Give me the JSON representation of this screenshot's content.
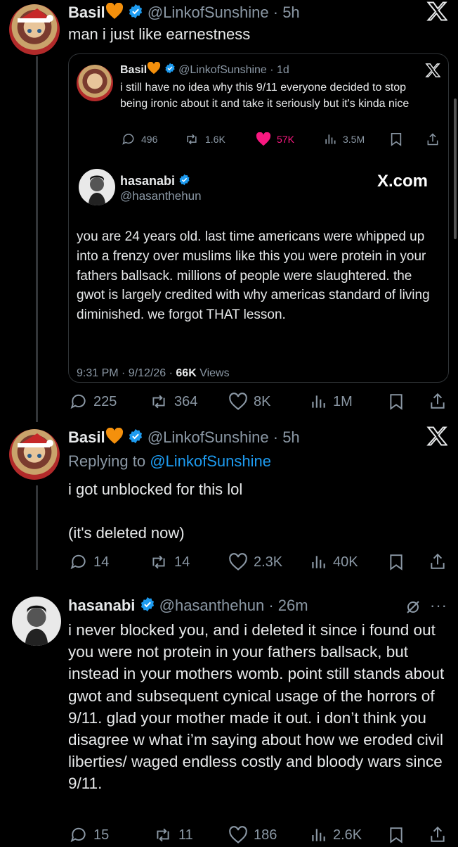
{
  "tweet1": {
    "name": "Basil",
    "handle": "@LinkofSunshine",
    "time": "5h",
    "text": "man i just like earnestness",
    "quote": {
      "name": "Basil",
      "handle": "@LinkofSunshine",
      "time": "1d",
      "text": "i still have no idea why this 9/11 everyone decided to stop being ironic about it and take it seriously but it's kinda nice",
      "stats": {
        "replies": "496",
        "reposts": "1.6K",
        "likes": "57K",
        "views": "3.5M"
      },
      "embed": {
        "name": "hasanabi",
        "handle": "@hasanthehun",
        "brand": "X.com",
        "text": "you are 24 years old. last time americans were whipped up into a frenzy over muslims like this you were protein in your fathers ballsack. millions of people were slaughtered. the gwot is largely credited with why americas standard of living diminished. we forgot THAT lesson.",
        "meta_prefix": "9:31 PM · 9/12/26 · ",
        "meta_views": "66K",
        "meta_suffix": " Views"
      }
    },
    "stats": {
      "replies": "225",
      "reposts": "364",
      "likes": "8K",
      "views": "1M"
    }
  },
  "tweet2": {
    "name": "Basil",
    "handle": "@LinkofSunshine",
    "time": "5h",
    "replying_prefix": "Replying to ",
    "replying_to": "@LinkofSunshine",
    "text1": "i got unblocked for this lol",
    "text2": "(it's deleted now)",
    "stats": {
      "replies": "14",
      "reposts": "14",
      "likes": "2.3K",
      "views": "40K"
    }
  },
  "tweet3": {
    "name": "hasanabi",
    "handle": "@hasanthehun",
    "time": "26m",
    "text": "i never blocked you, and i deleted it since i found out you were not protein in your fathers ballsack, but instead in your mothers womb. point still stands about gwot and subsequent cynical usage of the horrors of 9/11. glad your mother made it out. i don’t think you disagree w what i’m saying about how we eroded civil liberties/ waged endless costly and bloody wars since 9/11.",
    "stats": {
      "replies": "15",
      "reposts": "11",
      "likes": "186",
      "views": "2.6K"
    }
  },
  "colors": {
    "background": "#000000",
    "text": "#e7e9ea",
    "muted": "#8b98a5",
    "link": "#1d9bf0",
    "like": "#f91880",
    "heart_emoji": "#f4900c"
  }
}
